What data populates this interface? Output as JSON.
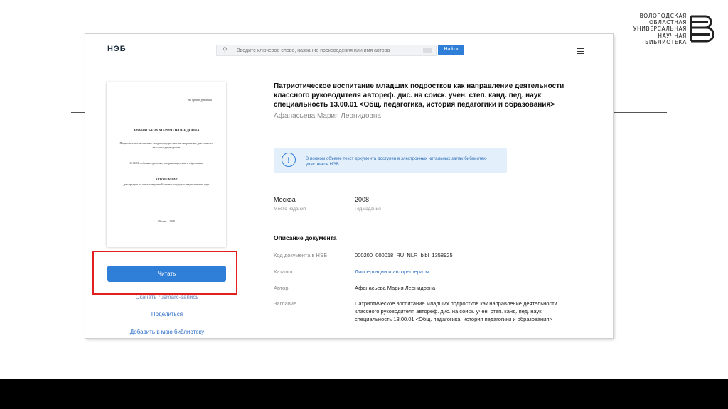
{
  "library": {
    "name_lines": [
      "ВОЛОГОДСКАЯ",
      "ОБЛАСТНАЯ",
      "УНИВЕРСАЛЬНАЯ",
      "НАУЧНАЯ",
      "БИБЛИОТЕКА"
    ]
  },
  "app": {
    "logo": "НЭБ",
    "search": {
      "placeholder": "Введите ключевое слово, название произведения или имя автора",
      "button": "Найти"
    }
  },
  "cover": {
    "corner": "На правах рукописи",
    "author": "АФАНАСЬЕВА МАРИЯ ЛЕОНИДОВНА",
    "title": "Патриотическое воспитание младших подростков как направление деятельности классного руководителя",
    "spec": "13.00.01 – общая педагогика, история педагогики и образования",
    "abstract": "АВТОРЕФЕРАТ",
    "degree": "диссертации на соискание ученой степени кандидата педагогических наук",
    "city": "Москва – 2008"
  },
  "sidebar": {
    "read_button": "Читать",
    "download_link": "Скачать rusmarc-запись",
    "share_link": "Поделиться",
    "add_link": "Добавить в мою библиотеку"
  },
  "document": {
    "title": "Патриотическое воспитание младших подростков как направление деятельности классного руководителя автореф. дис. на соиск. учен. степ. канд. пед. наук специальность 13.00.01 <Общ. педагогика, история педагогики и образования>",
    "author": "Афанасьева Мария Леонидовна",
    "notice": "В полном объеме текст документа доступен в электронных читальных залах библиотек-участников НЭБ",
    "place": {
      "value": "Москва",
      "label": "Место издания"
    },
    "year": {
      "value": "2008",
      "label": "Год издания"
    },
    "description_heading": "Описание документа",
    "rows": [
      {
        "label": "Код документа в НЭБ",
        "value": "000200_000018_RU_NLR_bibl_1358925"
      },
      {
        "label": "Каталог",
        "value": "Диссертации и авторефераты"
      },
      {
        "label": "Автор",
        "value": "Афанасьева Мария Леонидовна"
      },
      {
        "label": "Заглавие",
        "value": "Патриотическое воспитание младших подростков как направление деятельности классного руководителя автореф. дис. на соиск. учен. степ. канд. пед. наук специальность 13.00.01 <Общ. педагогика, история педагогики и образования>"
      }
    ]
  },
  "colors": {
    "accent": "#2f7ed8",
    "highlight": "#e01f1f",
    "notice_bg": "#e3effb"
  }
}
